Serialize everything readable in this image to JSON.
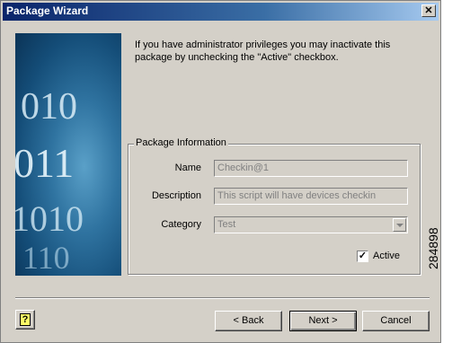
{
  "window": {
    "title": "Package Wizard",
    "close_glyph": "✕"
  },
  "side_image": {
    "digits_rows": [
      "010",
      "011",
      "1010",
      "110"
    ]
  },
  "intro_text": "If you have administrator privileges you may inactivate this package by unchecking the \"Active\" checkbox.",
  "package_info": {
    "legend": "Package Information",
    "name_label": "Name",
    "name_value": "Checkin@1",
    "description_label": "Description",
    "description_value": "This script will have devices checkin",
    "category_label": "Category",
    "category_value": "Test",
    "active_label": "Active",
    "active_checked": true,
    "check_glyph": "✓"
  },
  "buttons": {
    "help_glyph": "?",
    "back_label": "< Back",
    "next_label": "Next >",
    "cancel_label": "Cancel"
  },
  "figure_id": "284898"
}
